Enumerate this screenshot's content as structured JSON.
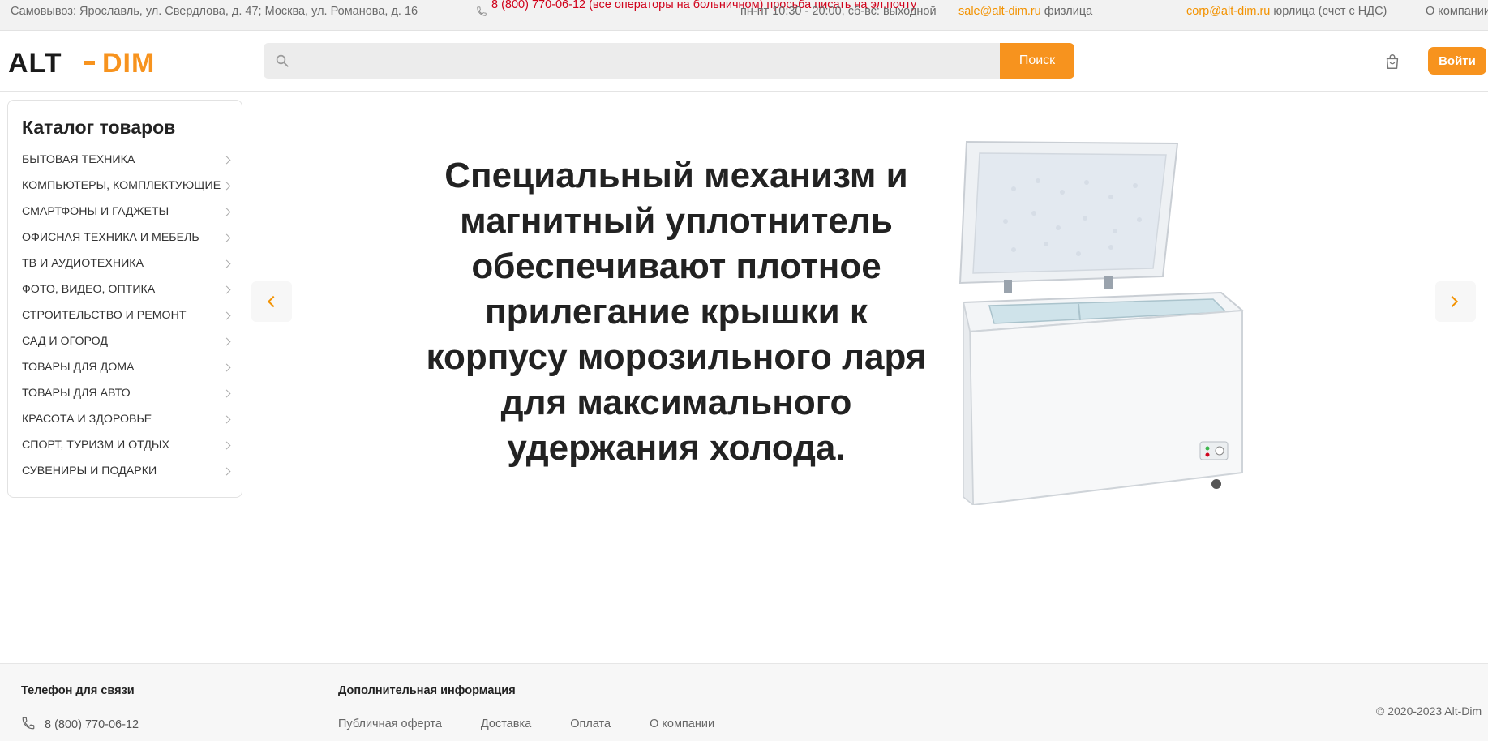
{
  "topbar": {
    "address": "Самовывоз: Ярославль, ул. Свердлова, д. 47; Москва, ул. Романова, д. 16",
    "phone": "8 (800) 770-06-12 (все операторы на больничном) просьба писать на эл.почту",
    "hours": "пн-пт 10:30 - 20:00, сб-вс: выходной",
    "sale_email": "sale@alt-dim.ru",
    "sale_suffix": " физлица",
    "corp_email": "corp@alt-dim.ru",
    "corp_suffix": " юрлица (счет с НДС)",
    "about": "О компании"
  },
  "header": {
    "logo_text": "ALT - DIM",
    "search_placeholder": "",
    "search_button": "Поиск",
    "login_button": "Войти"
  },
  "catalog": {
    "title": "Каталог товаров",
    "items": [
      "БЫТОВАЯ ТЕХНИКА",
      "КОМПЬЮТЕРЫ, КОМПЛЕКТУЮЩИЕ",
      "СМАРТФОНЫ И ГАДЖЕТЫ",
      "ОФИСНАЯ ТЕХНИКА И МЕБЕЛЬ",
      "ТВ И АУДИОТЕХНИКА",
      "ФОТО, ВИДЕО, ОПТИКА",
      "СТРОИТЕЛЬСТВО И РЕМОНТ",
      "САД И ОГОРОД",
      "ТОВАРЫ ДЛЯ ДОМА",
      "ТОВАРЫ ДЛЯ АВТО",
      "КРАСОТА И ЗДОРОВЬЕ",
      "СПОРТ, ТУРИЗМ И ОТДЫХ",
      "СУВЕНИРЫ И ПОДАРКИ"
    ]
  },
  "slider": {
    "text": "Специальный механизм и магнитный уплотнитель обеспечивают плотное прилегание крышки к корпусу морозильного ларя для максимального удержания холода."
  },
  "footer": {
    "phone_title": "Телефон для связи",
    "phone": "8 (800) 770-06-12",
    "info_title": "Дополнительная информация",
    "links": [
      "Публичная оферта",
      "Доставка",
      "Оплата",
      "О компании"
    ],
    "copyright": "© 2020-2023 Alt-Dim"
  },
  "colors": {
    "accent": "#f7931e",
    "phone_red": "#d0021b"
  }
}
